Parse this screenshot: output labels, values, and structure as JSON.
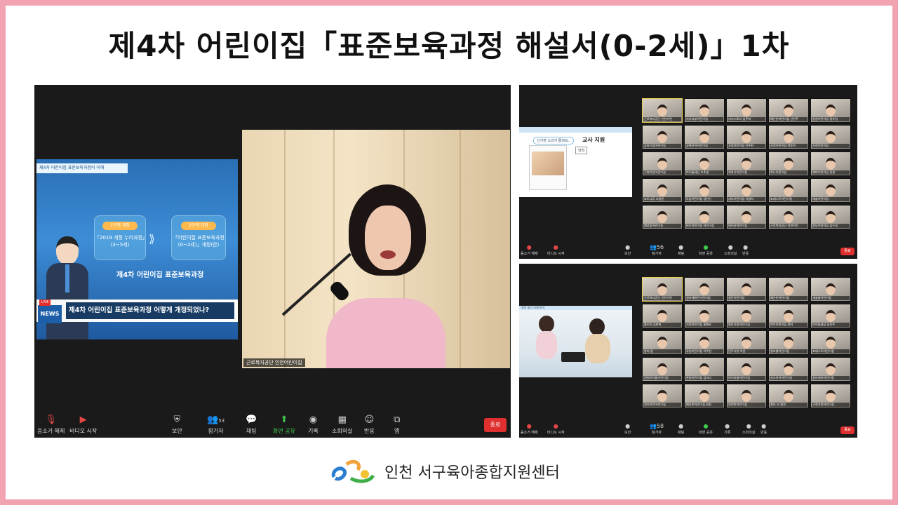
{
  "page": {
    "title": "제4차 어린이집「표준보육과정 해설서(0-2세)」1차",
    "footer_org": "인천 서구육아종합지원센터"
  },
  "colors": {
    "frame": "#f1a3b1",
    "end": "#e02f2f",
    "share": "#3fc84b"
  },
  "main_window": {
    "toolbar": [
      {
        "icon": "mic-muted-icon",
        "label": "음소거 해제"
      },
      {
        "icon": "video-off-icon",
        "label": "비디오 시작"
      },
      {
        "icon": "shield-icon",
        "label": "보안"
      },
      {
        "icon": "participants-icon",
        "label": "참가자",
        "count": "53"
      },
      {
        "icon": "chat-icon",
        "label": "채팅"
      },
      {
        "icon": "share-screen-icon",
        "label": "화면 공유"
      },
      {
        "icon": "record-icon",
        "label": "기록"
      },
      {
        "icon": "breakout-icon",
        "label": "소회의실"
      },
      {
        "icon": "reaction-icon",
        "label": "반응"
      },
      {
        "icon": "apps-icon",
        "label": "앱"
      }
    ],
    "end_label": "종료",
    "slide": {
      "header": "제4차 어린이집 표준보육과정의 이해",
      "box1_tag": "1단계 개정",
      "box1_text": [
        "「2019 개정 누리과정」",
        "(3~5세)"
      ],
      "box2_tag": "2단계 개정",
      "box2_text": [
        "「어린이집 표준보육과정",
        "(0~2세)」개정(안)"
      ],
      "mid_title": "제4차 어린이집 표준보육과정",
      "news_live": "LIVE",
      "news_badge": "NEWS",
      "news_ticker": "제4차 어린이집 표준보육과정 어떻게 개정되었나?"
    },
    "speaker_name": "근로복지공단 인천어린이집"
  },
  "small_window_1": {
    "slide": {
      "pill": "신기한 소리가 들려요..",
      "title": "교사 지원",
      "warn": "안전"
    },
    "participants": [
      "근로복지공단 인천어린",
      "가사서부어린이집",
      "키즈스토리 김주희",
      "예은빈어린이집 신현주",
      "동원어린이집 정유림",
      "공마드림어린이집",
      "상록은하어린이집",
      "가정어린이집 이주현",
      "신정어린이집 박윤아",
      "가정어린이집",
      "구청가정어린이집",
      "아이들세상 조주영",
      "지하나어린이집",
      "하나어린이집",
      "해피어린이집 민정",
      "포도나무 조정윤",
      "도담어린이집 김현선",
      "서부어린이집 이명희",
      "포레스트어린이집",
      "새솔어린이집",
      "예음동어린이집",
      "바다어린이집 어린이집",
      "태어난어린이집",
      "근로복지공단 인천어린",
      "원당어린이집 김수경"
    ],
    "toolbar": [
      "음소거 해제",
      "비디오 시작",
      "보안",
      "참가자",
      "채팅",
      "화면 공유",
      "소회의실",
      "반응"
    ],
    "participant_count": "56",
    "end_label": "종료"
  },
  "small_window_2": {
    "slide_bar": "영아 놀이 사례 분석",
    "participants": [
      "근로복지공단 인천어린",
      "청라해맑은어린이집",
      "청운어린이집",
      "예은빈어린이집",
      "새솔봄어린이집",
      "룰리이 김현희",
      "가정어린이집 홍예은",
      "원당가정어린이집",
      "피아어린이집 정미",
      "아이들세상 김은주",
      "종희 원",
      "루원어린이집 이주현",
      "민주사랑 이윤",
      "청라별어린이집",
      "포레스트어린이집",
      "정원아이들어린이집",
      "한빛어린이집 김미나",
      "아이마을어린이집",
      "키즈아이어린이집",
      "청라에듀어린이집",
      "청라하이어린이집",
      "예은빈어린이집 원장",
      "인천만어린이집",
      "청라 서 원장",
      "구청가정어린이집"
    ],
    "toolbar": [
      "음소거 해제",
      "비디오 시작",
      "보안",
      "참가자",
      "채팅",
      "화면 공유",
      "기록",
      "소회의실",
      "반응"
    ],
    "participant_count": "58",
    "end_label": "종료"
  }
}
